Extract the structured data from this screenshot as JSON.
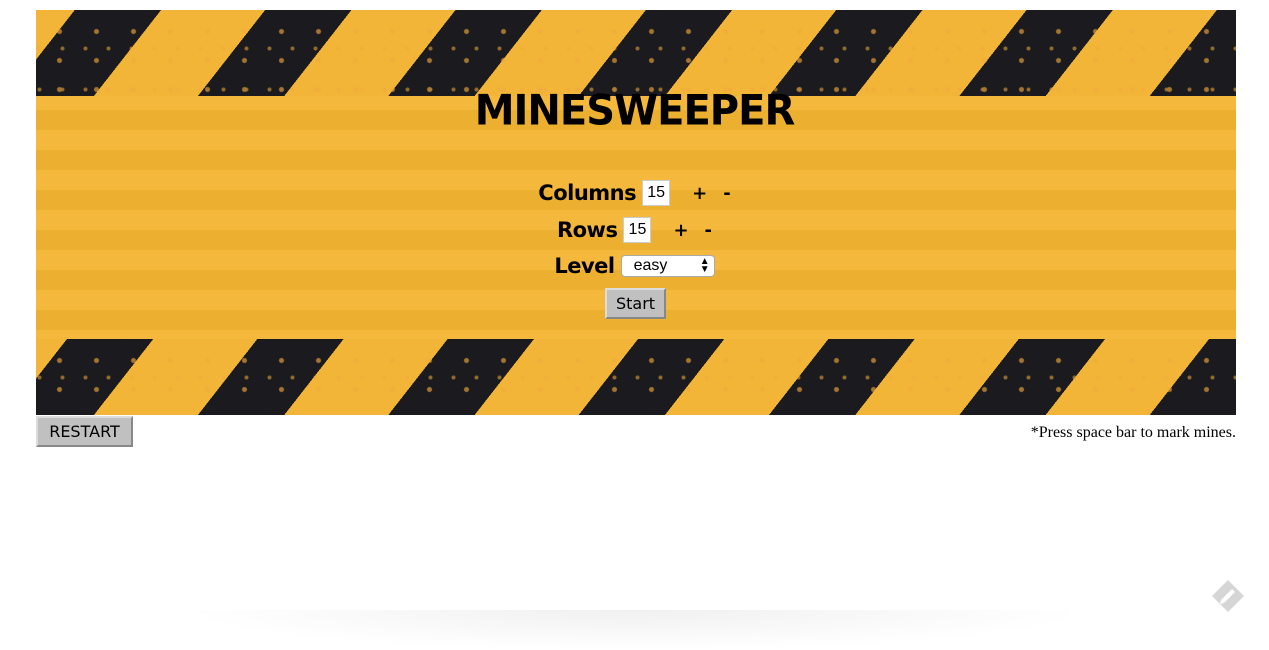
{
  "game": {
    "title": "MINESWEEPER",
    "columns": {
      "label": "Columns",
      "value": "15",
      "plus": "+",
      "minus": "-"
    },
    "rows": {
      "label": "Rows",
      "value": "15",
      "plus": "+",
      "minus": "-"
    },
    "level": {
      "label": "Level",
      "selected": "easy"
    },
    "start_label": "Start"
  },
  "footer": {
    "restart_label": "RESTART",
    "hint": "*Press space bar to mark mines."
  },
  "icons": {
    "select_arrows": "updown-arrows-icon",
    "corner": "edit-feather-icon"
  },
  "colors": {
    "banner_yellow": "#f4b532",
    "stripe_black": "#1b1a1e",
    "button_gray": "#c0c0c0"
  }
}
